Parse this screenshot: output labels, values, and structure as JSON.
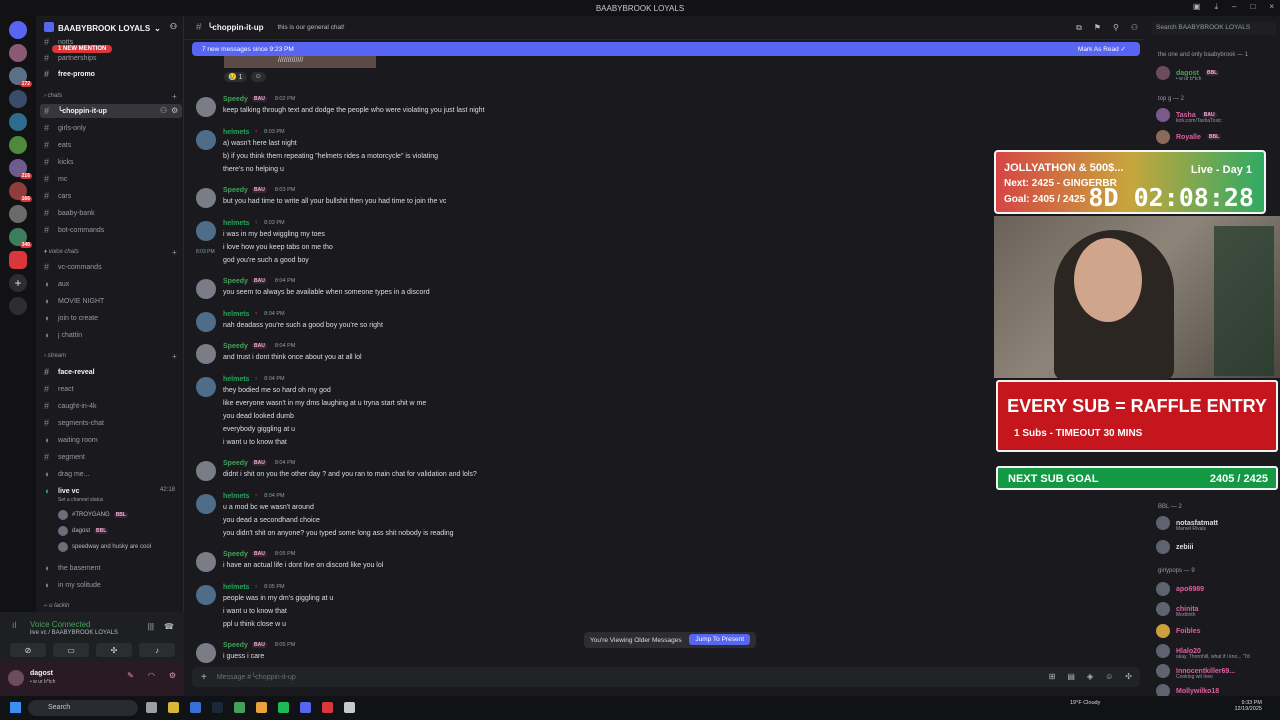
{
  "window": {
    "title": "BAABYBROOK LOYALS"
  },
  "server": {
    "name": "BAABYBROOK LOYALS",
    "new_mention": "1 NEW MENTION"
  },
  "guild_badges": [
    "172",
    "216",
    "166",
    "346"
  ],
  "channels": {
    "top": [
      "notts",
      "partnerships",
      "free-promo"
    ],
    "cat_chats": "chats",
    "chats": [
      "╰choppin-it-up",
      "girls-only",
      "eats",
      "kicks",
      "mc",
      "cars",
      "baaby-bank",
      "bot-commands"
    ],
    "cat_voice": "voice chats",
    "voice": [
      "vc-commands",
      "aux",
      "MOVIE NIGHT",
      "join to create",
      "j chattin"
    ],
    "cat_stream": "stream",
    "stream": [
      "face-reveal",
      "react",
      "caught-in-4k",
      "segments-chat",
      "waiting room",
      "segment",
      "drag me..."
    ],
    "live_vc": {
      "name": "live vc",
      "time": "42:18",
      "status": "Set a channel status"
    },
    "vc_users": [
      {
        "name": "#TROYGANG",
        "badge": "BBL"
      },
      {
        "name": "dagost",
        "badge": "BBL"
      },
      {
        "name": "speedway and husky are cool",
        "badge": ""
      }
    ],
    "after": [
      "the basement",
      "in my solitude"
    ],
    "cat_lackin": "u lackin"
  },
  "voice_panel": {
    "title": "Voice Connected",
    "sub": "live vc / BAABYBROOK LOYALS"
  },
  "user_panel": {
    "name": "dagost",
    "status": "• w ur b*tch"
  },
  "chat": {
    "channel": "╰choppin-it-up",
    "topic": "this is our general chat!",
    "banner": "7 new messages since 9:23 PM",
    "mark_read": "Mark As Read",
    "img_text": "/////////////",
    "reactions": [
      {
        "emoji": "😢",
        "count": "1"
      },
      {
        "emoji": "☺",
        "count": ""
      }
    ],
    "placeholder": "Message #╰choppin-it-up",
    "jump_text": "You're Viewing Older Messages",
    "jump_btn": "Jump To Present",
    "hover_time": "8:03 PM",
    "messages": [
      {
        "author": "Speedy",
        "tag": "BAU",
        "time": "8:02 PM",
        "lines": [
          "keep talking through text and dodge the people who were violating you just last night"
        ]
      },
      {
        "author": "helmets",
        "tag": "",
        "time": "8:03 PM",
        "lines": [
          "a) wasn't here last night",
          "b) if you think them repeating \"helmets rides a motorcycle\" is violating",
          "there's no helping u"
        ]
      },
      {
        "author": "Speedy",
        "tag": "BAU",
        "time": "8:03 PM",
        "lines": [
          "but you had time to write all your bullshit then you had time to join the vc"
        ]
      },
      {
        "author": "helmets",
        "tag": "",
        "time": "8:03 PM",
        "lines": [
          "i was in my bed wiggling my toes",
          "i love how you keep tabs on me tho",
          "god you're such a good boy"
        ]
      },
      {
        "author": "Speedy",
        "tag": "BAU",
        "time": "8:04 PM",
        "lines": [
          "you seem to always be available when someone types in a discord"
        ]
      },
      {
        "author": "helmets",
        "tag": "",
        "time": "8:04 PM",
        "lines": [
          "nah deadass you're such a good boy you're so right"
        ]
      },
      {
        "author": "Speedy",
        "tag": "BAU",
        "time": "8:04 PM",
        "lines": [
          "and trust i dont think once about you at all lol"
        ]
      },
      {
        "author": "helmets",
        "tag": "",
        "time": "8:04 PM",
        "lines": [
          "they bodied me so hard oh my god",
          "like everyone wasn't in my dms laughing at u tryna start shit w me",
          "you dead looked dumb",
          "everybody giggling at u",
          "i want u to know that"
        ]
      },
      {
        "author": "Speedy",
        "tag": "BAU",
        "time": "8:04 PM",
        "lines": [
          "didnt i shit on you the other day ? and you ran to main chat for validation and lols?"
        ]
      },
      {
        "author": "helmets",
        "tag": "",
        "time": "8:04 PM",
        "lines": [
          "u a mod bc we wasn't around",
          "you dead a secondhand choice",
          "you didn't shit on anyone? you typed some long ass shit nobody is reading"
        ]
      },
      {
        "author": "Speedy",
        "tag": "BAU",
        "time": "8:05 PM",
        "lines": [
          "i have an actual life i dont live on discord like you lol"
        ]
      },
      {
        "author": "helmets",
        "tag": "",
        "time": "8:05 PM",
        "lines": [
          "people was in my dm's giggling at u",
          "i want u to know that",
          "ppl u think close w u"
        ]
      },
      {
        "author": "Speedy",
        "tag": "BAU",
        "time": "8:05 PM",
        "lines": [
          "i guess i care"
        ]
      }
    ]
  },
  "search": {
    "placeholder": "Search BAABYBROOK LOYALS"
  },
  "members": {
    "owner_head": "the one and only baabybrook — 1",
    "owner": {
      "name": "dagost",
      "badge": "BBL",
      "sub": "• w ur b*tch"
    },
    "top_head": "top g — 2",
    "top": [
      {
        "name": "Tasha",
        "badge": "BAU",
        "sub": "kick.com/TashaToxic"
      },
      {
        "name": "Royalle",
        "badge": "BBL",
        "sub": ""
      }
    ],
    "bbl_head": "BBL — 2",
    "bbl": [
      {
        "name": "notasfatmatt",
        "sub": "Marvel Rivals"
      },
      {
        "name": "zebiii",
        "sub": ""
      }
    ],
    "girly_head": "girlypops — 9",
    "girly": [
      {
        "name": "apo6989",
        "sub": ""
      },
      {
        "name": "chinita",
        "sub": "Modrinth"
      },
      {
        "name": "Foibles",
        "sub": ""
      },
      {
        "name": "Hlalo20",
        "sub": "okay, Thorohill, what if i kno... \"I'd"
      },
      {
        "name": "Innocentkiller69...",
        "sub": "Cooking wit Ineo"
      },
      {
        "name": "Mollywilko18",
        "sub": ""
      }
    ]
  },
  "overlay": {
    "title": "JOLLYATHON & 500$...",
    "live": "Live - Day 1",
    "next": "Next: 2425 - GINGERBR",
    "goal": "Goal: 2405 / 2425",
    "timer": "8D 02:08:28",
    "raffle": "EVERY SUB = RAFFLE ENTRY",
    "raffle_sub": "1 Subs - TIMEOUT 30 MINS",
    "next_goal_label": "NEXT SUB GOAL",
    "next_goal_value": "2405 / 2425"
  },
  "taskbar": {
    "search": "Search",
    "weather": "19°F Cloudy",
    "time": "9:33 PM",
    "date": "12/19/2025"
  },
  "colors": {
    "accent": "#5865f2",
    "speedy": "#43a25a",
    "helmets": "#23a55a",
    "mention": "#da373c"
  }
}
